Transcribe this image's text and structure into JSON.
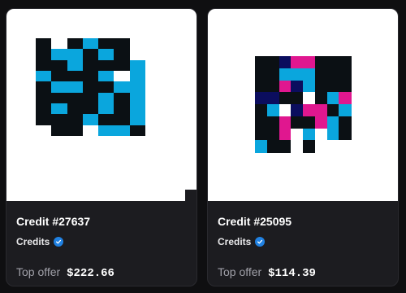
{
  "colors": {
    "black": "#0b1014",
    "cyan": "#0aa6dd",
    "pink": "#e0178f",
    "navy": "#0b0d5e",
    "white": "#ffffff"
  },
  "cards": [
    {
      "name": "Credit #27637",
      "collection": "Credits",
      "offer_label": "Top offer",
      "offer_price": "$222.66",
      "art_rows": [
        "b.bcbb.",
        "bccbcb.",
        "bbcbbbc",
        "cbbbc.c",
        "bccbbcc",
        "bbbbcbc",
        "bcbbcbc",
        "bbbcbbc",
        ".bb.ccb"
      ]
    },
    {
      "name": "Credit #25095",
      "collection": "Credits",
      "offer_label": "Top offer",
      "offer_price": "$114.39",
      "art_rows": [
        "bbnppbbb",
        "bbcccbbb",
        "bbpncbbb",
        "nnbb.bcp",
        "bc.nppbc",
        "bbpbbpcb",
        "bbp.c.cb",
        "cbb.b..."
      ]
    }
  ]
}
